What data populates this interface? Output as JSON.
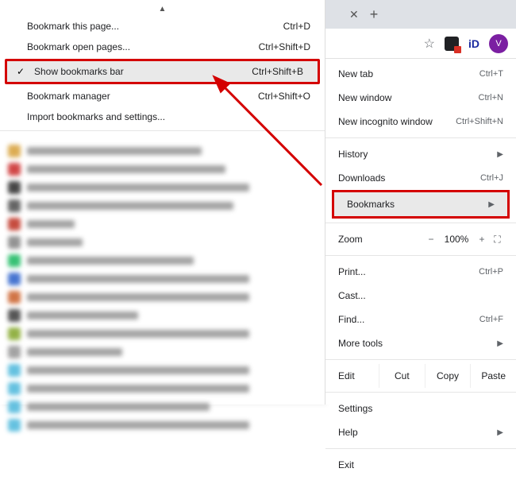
{
  "submenu": {
    "items": [
      {
        "label": "Bookmark this page...",
        "shortcut": "Ctrl+D",
        "checked": false
      },
      {
        "label": "Bookmark open pages...",
        "shortcut": "Ctrl+Shift+D",
        "checked": false
      },
      {
        "label": "Show bookmarks bar",
        "shortcut": "Ctrl+Shift+B",
        "checked": true,
        "highlighted": true,
        "boxed": true
      },
      {
        "label": "Bookmark manager",
        "shortcut": "Ctrl+Shift+O",
        "checked": false
      },
      {
        "label": "Import bookmarks and settings...",
        "shortcut": "",
        "checked": false
      }
    ]
  },
  "toolbar": {
    "avatar_letter": "V"
  },
  "menu": {
    "new_tab": {
      "label": "New tab",
      "shortcut": "Ctrl+T"
    },
    "new_window": {
      "label": "New window",
      "shortcut": "Ctrl+N"
    },
    "new_incognito": {
      "label": "New incognito window",
      "shortcut": "Ctrl+Shift+N"
    },
    "history": {
      "label": "History"
    },
    "downloads": {
      "label": "Downloads",
      "shortcut": "Ctrl+J"
    },
    "bookmarks": {
      "label": "Bookmarks"
    },
    "zoom": {
      "label": "Zoom",
      "minus": "−",
      "value": "100%",
      "plus": "+",
      "full": "⛶"
    },
    "print": {
      "label": "Print...",
      "shortcut": "Ctrl+P"
    },
    "cast": {
      "label": "Cast..."
    },
    "find": {
      "label": "Find...",
      "shortcut": "Ctrl+F"
    },
    "more_tools": {
      "label": "More tools"
    },
    "edit": {
      "label": "Edit",
      "cut": "Cut",
      "copy": "Copy",
      "paste": "Paste"
    },
    "settings": {
      "label": "Settings"
    },
    "help": {
      "label": "Help"
    },
    "exit": {
      "label": "Exit"
    }
  },
  "annotations": {
    "highlight_color": "#d40000"
  }
}
